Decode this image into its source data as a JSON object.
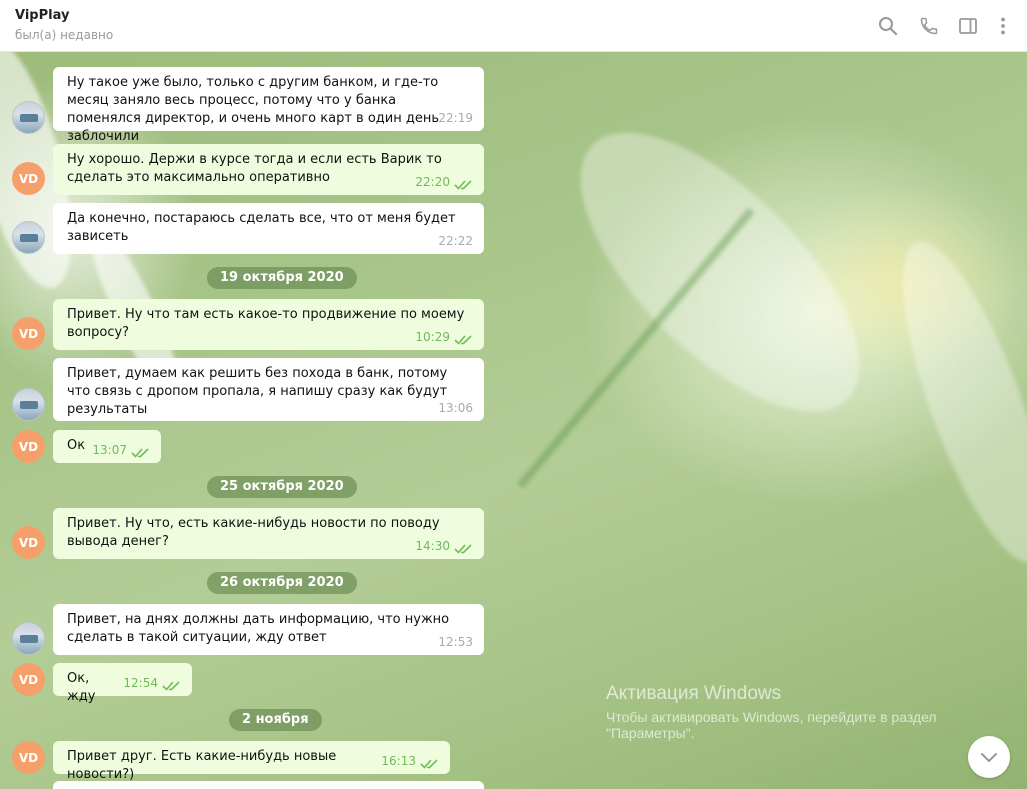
{
  "header": {
    "title": "VipPlay",
    "status": "был(а) недавно",
    "icons": [
      "search-icon",
      "phone-icon",
      "sidebar-toggle-icon",
      "more-vertical-icon"
    ]
  },
  "avatars": {
    "vd_initials": "VD"
  },
  "messages": [
    {
      "dir": "in",
      "text": "Ну такое уже было, только с другим банком,  и где-то  месяц заняло весь процесс, потому что  у банка поменялся  директор, и очень много  карт в один день заблочили",
      "time": "22:19"
    },
    {
      "dir": "out",
      "text": "Ну хорошо. Держи в курсе тогда и если есть Варик то сделать это максимально оперативно",
      "time": "22:20",
      "read": true
    },
    {
      "dir": "in",
      "text": "Да конечно, постараюсь  сделать все, что от меня будет зависеть",
      "time": "22:22"
    },
    {
      "date": "19 октября 2020"
    },
    {
      "dir": "out",
      "text": "Привет. Ну что там есть какое-то продвижение по моему вопросу?",
      "time": "10:29",
      "read": true
    },
    {
      "dir": "in",
      "text": "Привет, думаем как решить без похода в банк, потому что связь с дропом пропала, я напишу  сразу как будут  результаты",
      "time": "13:06"
    },
    {
      "dir": "out",
      "text": "Ок",
      "time": "13:07",
      "read": true
    },
    {
      "date": "25 октября 2020"
    },
    {
      "dir": "out",
      "text": "Привет. Ну что, есть какие-нибудь новости по поводу вывода денег?",
      "time": "14:30",
      "read": true
    },
    {
      "date": "26 октября 2020"
    },
    {
      "dir": "in",
      "text": "Привет, на днях  должны дать информацию,  что нужно сделать в такой ситуации, жду ответ",
      "time": "12:53"
    },
    {
      "dir": "out",
      "text": "Ок, жду",
      "time": "12:54",
      "read": true
    },
    {
      "date": "2 ноября"
    },
    {
      "dir": "out",
      "text": "Привет друг. Есть какие-нибудь новые новости?)",
      "time": "16:13",
      "read": true
    }
  ],
  "watermark": {
    "title": "Активация Windows",
    "subtitle": "Чтобы активировать Windows, перейдите в раздел \"Параметры\"."
  },
  "colors": {
    "outgoing_bubble": "#effdde",
    "incoming_bubble": "#ffffff",
    "read_ticks": "#6cbc57",
    "avatar_vd": "#f5a06a"
  }
}
